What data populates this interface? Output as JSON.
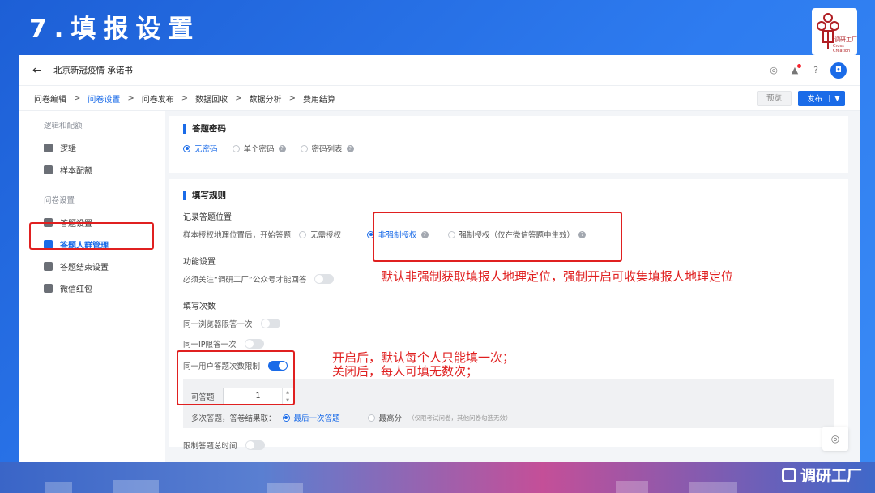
{
  "slide": {
    "title": "7.填报设置"
  },
  "app": {
    "title": "北京新冠疫情 承诺书"
  },
  "steps": [
    "问卷编辑",
    "问卷设置",
    "问卷发布",
    "数据回收",
    "数据分析",
    "费用结算"
  ],
  "actions": {
    "preview": "预览",
    "publish": "发布"
  },
  "sidebar": {
    "group1": "逻辑和配额",
    "logic": "逻辑",
    "quota": "样本配额",
    "group2": "问卷设置",
    "answer_settings": "答题设置",
    "crowd": "答题人群管理",
    "finish": "答题结束设置",
    "redpacket": "微信红包"
  },
  "password": {
    "title": "答题密码",
    "options": [
      "无密码",
      "单个密码",
      "密码列表"
    ]
  },
  "rules": {
    "title": "填写规则",
    "location_title": "记录答题位置",
    "location_desc": "样本授权地理位置后，开始答题",
    "location_options": [
      "无需授权",
      "非强制授权",
      "强制授权（仅在微信答题中生效）"
    ],
    "func_title": "功能设置",
    "follow": "必须关注“调研工厂”公众号才能回答",
    "times_title": "填写次数",
    "browser_once": "同一浏览器限答一次",
    "ip_once": "同一IP限答一次",
    "user_limit": "同一用户答题次数限制",
    "can_answer": "可答题",
    "count_value": "1",
    "multi_label": "多次答题，答卷结果取：",
    "multi_opt1": "最后一次答题",
    "multi_opt2": "最高分",
    "multi_note": "（仅限考试问卷，其他问卷勾选无效）",
    "total_time": "限制答题总时间"
  },
  "annotations": {
    "note1": "默认非强制获取填报人地理定位，强制开启可收集填报人地理定位",
    "note2_line1": "开启后，默认每个人只能填一次；",
    "note2_line2": "关闭后，每人可填无数次；"
  },
  "brand": {
    "seal": "调研工厂",
    "seal_sub": "Cross Creation",
    "corner": "调研工厂"
  }
}
